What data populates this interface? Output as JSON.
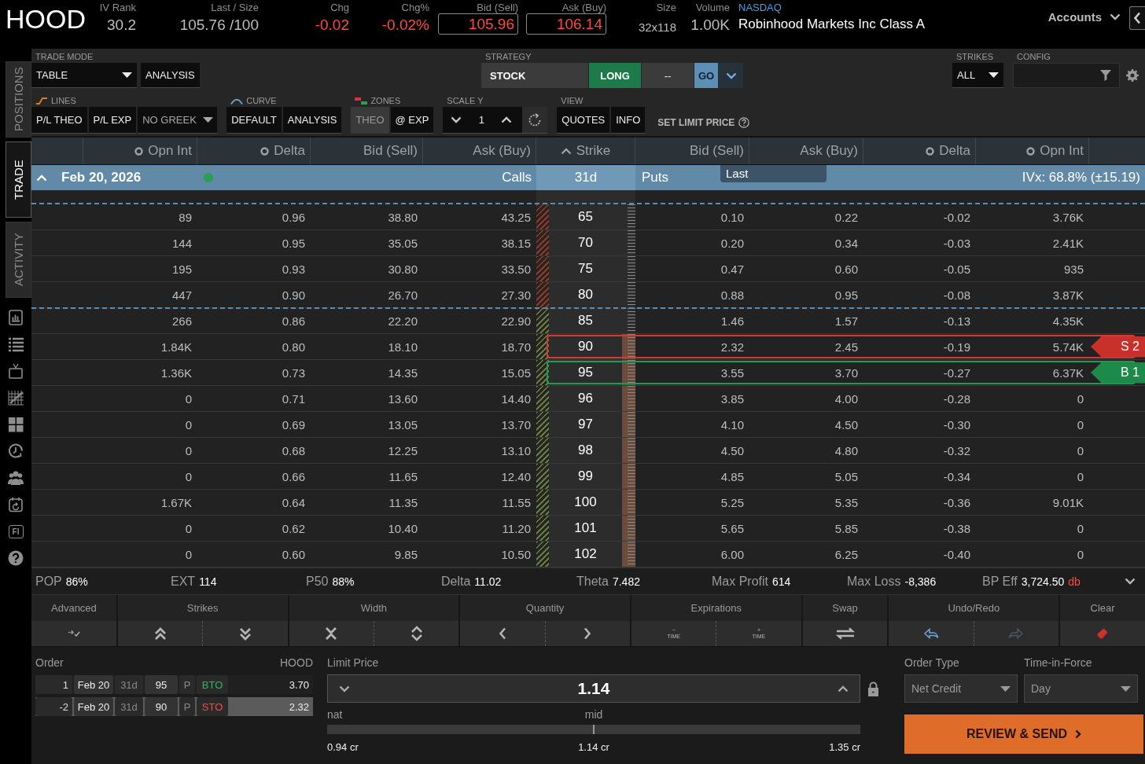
{
  "quote": {
    "symbol": "HOOD",
    "fields": [
      {
        "label": "IV Rank",
        "value": "30.2",
        "kind": "plain"
      },
      {
        "label": "Last / Size",
        "value": "105.76 /100",
        "kind": "plain"
      },
      {
        "label": "Chg",
        "value": "-0.02",
        "kind": "down"
      },
      {
        "label": "Chg%",
        "value": "-0.02%",
        "kind": "down"
      },
      {
        "label": "Bid (Sell)",
        "value": "105.96",
        "kind": "boxed"
      },
      {
        "label": "Ask (Buy)",
        "value": "106.14",
        "kind": "boxed"
      },
      {
        "label": "Size",
        "value": "32x118",
        "kind": "small"
      },
      {
        "label": "Volume",
        "value": "1.00K",
        "kind": "plain"
      }
    ],
    "exchange": "NASDAQ",
    "company": "Robinhood Markets Inc Class A",
    "accounts": "Accounts"
  },
  "sidebar": {
    "tabs": [
      {
        "label": "POSITIONS",
        "selected": false
      },
      {
        "label": "TRADE",
        "selected": true
      },
      {
        "label": "ACTIVITY",
        "selected": false
      }
    ],
    "icon_text": "FI"
  },
  "toolbar": {
    "trade_mode": {
      "label": "TRADE MODE",
      "value": "TABLE",
      "button": "ANALYSIS"
    },
    "strategy": {
      "label": "STRATEGY",
      "type": "STOCK",
      "side": "LONG",
      "spread": "--",
      "go": "GO"
    },
    "strikes": {
      "label": "STRIKES",
      "value": "ALL"
    },
    "config": {
      "label": "CONFIG"
    },
    "groups": [
      {
        "label": "LINES",
        "kind": "lines",
        "options": [
          {
            "text": "P/L THEO",
            "on": true
          },
          {
            "text": "P/L EXP",
            "on": true
          }
        ],
        "dropdown": "NO GREEK"
      },
      {
        "label": "CURVE",
        "kind": "curve",
        "options": [
          {
            "text": "DEFAULT",
            "on": true
          },
          {
            "text": "ANALYSIS",
            "on": true
          }
        ]
      },
      {
        "label": "ZONES",
        "kind": "zones",
        "options": [
          {
            "text": "THEO",
            "on": false
          },
          {
            "text": "@ EXP",
            "on": true
          }
        ]
      },
      {
        "label": "SCALE Y",
        "kind": "scale",
        "value": "1"
      },
      {
        "label": "VIEW",
        "kind": "plain",
        "options": [
          {
            "text": "QUOTES",
            "on": true
          },
          {
            "text": "INFO",
            "on": true
          }
        ]
      }
    ],
    "set_limit_price": "SET LIMIT PRICE"
  },
  "chain": {
    "columns": [
      {
        "label": "Opn Int",
        "kind": "toggle"
      },
      {
        "label": "Delta",
        "kind": "toggle"
      },
      {
        "label": "Bid (Sell)",
        "kind": "plain"
      },
      {
        "label": "Ask (Buy)",
        "kind": "plain"
      },
      {
        "label": "Strike",
        "kind": "sorted"
      },
      {
        "label": "Bid (Sell)",
        "kind": "plain"
      },
      {
        "label": "Ask (Buy)",
        "kind": "plain"
      },
      {
        "label": "Delta",
        "kind": "toggle"
      },
      {
        "label": "Opn Int",
        "kind": "toggle"
      }
    ],
    "series": {
      "expiry": "Feb 20, 2026",
      "expanded": true,
      "calls": "Calls",
      "days": "31d",
      "puts": "Puts",
      "tooltip": "Last",
      "ivx": "IVx: 68.8% (±15.19)"
    },
    "rows": [
      {
        "cells": [
          "89",
          "0.96",
          "38.80",
          "43.25",
          "65",
          "0.10",
          "0.22",
          "-0.02",
          "3.76K"
        ],
        "color": "#8b3b2b",
        "bar": false,
        "dashed_below": false,
        "selected": false
      },
      {
        "cells": [
          "144",
          "0.95",
          "35.05",
          "38.15",
          "70",
          "0.20",
          "0.34",
          "-0.03",
          "2.41K"
        ],
        "color": "#8b3b2b",
        "bar": false,
        "dashed_below": false,
        "selected": false
      },
      {
        "cells": [
          "195",
          "0.93",
          "30.80",
          "33.50",
          "75",
          "0.47",
          "0.60",
          "-0.05",
          "935"
        ],
        "color": "#8b3b2b",
        "bar": false,
        "dashed_below": false,
        "selected": false
      },
      {
        "cells": [
          "447",
          "0.90",
          "26.70",
          "27.30",
          "80",
          "0.88",
          "0.95",
          "-0.08",
          "3.87K"
        ],
        "color": "#8b3b2b",
        "bar": false,
        "dashed_below": true,
        "selected": false
      },
      {
        "cells": [
          "266",
          "0.86",
          "22.20",
          "22.90",
          "85",
          "1.46",
          "1.57",
          "-0.13",
          "4.35K"
        ],
        "color": "#5f7d45",
        "bar": false,
        "dashed_below": false,
        "selected": false
      },
      {
        "cells": [
          "1.84K",
          "0.80",
          "18.10",
          "18.70",
          "90",
          "2.32",
          "2.45",
          "-0.19",
          "5.74K"
        ],
        "color": "#5f7d45",
        "bar": true,
        "dashed_below": false,
        "selected": true,
        "tag": {
          "text": "S 2",
          "kind": "sell"
        }
      },
      {
        "cells": [
          "1.36K",
          "0.73",
          "14.35",
          "15.05",
          "95",
          "3.55",
          "3.70",
          "-0.27",
          "6.37K"
        ],
        "color": "#5f7d45",
        "bar": true,
        "dashed_below": false,
        "selected": true,
        "tag": {
          "text": "B 1",
          "kind": "buy"
        }
      },
      {
        "cells": [
          "0",
          "0.71",
          "13.60",
          "14.40",
          "96",
          "3.85",
          "4.00",
          "-0.28",
          "0"
        ],
        "color": "#5f7d45",
        "bar": true,
        "dashed_below": false,
        "selected": false
      },
      {
        "cells": [
          "0",
          "0.69",
          "13.05",
          "13.70",
          "97",
          "4.10",
          "4.50",
          "-0.30",
          "0"
        ],
        "color": "#5f7d45",
        "bar": true,
        "dashed_below": false,
        "selected": false
      },
      {
        "cells": [
          "0",
          "0.68",
          "12.25",
          "13.10",
          "98",
          "4.50",
          "4.80",
          "-0.32",
          "0"
        ],
        "color": "#5f7d45",
        "bar": true,
        "dashed_below": false,
        "selected": false
      },
      {
        "cells": [
          "0",
          "0.66",
          "11.65",
          "12.40",
          "99",
          "4.85",
          "5.05",
          "-0.34",
          "0"
        ],
        "color": "#5f7d45",
        "bar": true,
        "dashed_below": false,
        "selected": false
      },
      {
        "cells": [
          "1.67K",
          "0.64",
          "11.35",
          "11.55",
          "100",
          "5.25",
          "5.35",
          "-0.36",
          "9.01K"
        ],
        "color": "#5f7d45",
        "bar": true,
        "dashed_below": false,
        "selected": false
      },
      {
        "cells": [
          "0",
          "0.62",
          "10.40",
          "11.20",
          "101",
          "5.65",
          "5.85",
          "-0.38",
          "0"
        ],
        "color": "#5f7d45",
        "bar": true,
        "dashed_below": false,
        "selected": false
      },
      {
        "cells": [
          "0",
          "0.60",
          "9.85",
          "10.50",
          "102",
          "6.00",
          "6.25",
          "-0.40",
          "0"
        ],
        "color": "#5f7d45",
        "bar": true,
        "dashed_below": false,
        "selected": false
      }
    ]
  },
  "stats": [
    {
      "label": "POP",
      "value": "86%"
    },
    {
      "label": "EXT",
      "value": "114"
    },
    {
      "label": "P50",
      "value": "88%"
    },
    {
      "label": "Delta",
      "value": "11.02"
    },
    {
      "label": "Theta",
      "value": "7.482"
    },
    {
      "label": "Max Profit",
      "value": "614"
    },
    {
      "label": "Max Loss",
      "value": "-8,386"
    },
    {
      "label": "BP Eff",
      "value": "3,724.50",
      "unit": "db"
    }
  ],
  "actions": [
    {
      "label": "Advanced",
      "buttons": [
        {
          "kind": "advanced",
          "disabled": false
        }
      ]
    },
    {
      "label": "Strikes",
      "buttons": [
        {
          "kind": "up",
          "disabled": false
        },
        {
          "kind": "down",
          "disabled": false
        }
      ]
    },
    {
      "label": "Width",
      "buttons": [
        {
          "kind": "narrow",
          "disabled": false
        },
        {
          "kind": "widen",
          "disabled": false
        }
      ]
    },
    {
      "label": "Quantity",
      "buttons": [
        {
          "kind": "decrease",
          "disabled": false
        },
        {
          "kind": "increase",
          "disabled": false
        }
      ]
    },
    {
      "label": "Expirations",
      "buttons": [
        {
          "kind": "time",
          "sign": "−",
          "text": "TIME",
          "disabled": false
        },
        {
          "kind": "time",
          "sign": "+",
          "text": "TIME",
          "disabled": false
        }
      ]
    },
    {
      "label": "Swap",
      "buttons": [
        {
          "kind": "swap",
          "disabled": false
        }
      ]
    },
    {
      "label": "Undo/Redo",
      "buttons": [
        {
          "kind": "undo",
          "disabled": false
        },
        {
          "kind": "redo",
          "disabled": true
        }
      ]
    },
    {
      "label": "Clear",
      "buttons": [
        {
          "kind": "clear",
          "disabled": false
        }
      ]
    }
  ],
  "order": {
    "title": "Order",
    "symbol": "HOOD",
    "legs": [
      {
        "qty": "1",
        "date": "Feb 20",
        "days": "31d",
        "strike": "95",
        "type": "P",
        "action": "BTO",
        "kind": "buy",
        "price": "3.70",
        "selected": false
      },
      {
        "qty": "-2",
        "date": "Feb 20",
        "days": "31d",
        "strike": "90",
        "type": "P",
        "action": "STO",
        "kind": "sell",
        "price": "2.32",
        "selected": true
      }
    ]
  },
  "limit_price": {
    "label": "Limit Price",
    "value": "1.14",
    "nat_label": "nat",
    "mid_label": "mid",
    "level": 0.5,
    "low": "0.94 cr",
    "mid": "1.14 cr",
    "high": "1.35 cr"
  },
  "order_type": {
    "label": "Order Type",
    "value": "Net Credit"
  },
  "time_in_force": {
    "label": "Time-in-Force",
    "value": "Day"
  },
  "submit": "REVIEW & SEND"
}
